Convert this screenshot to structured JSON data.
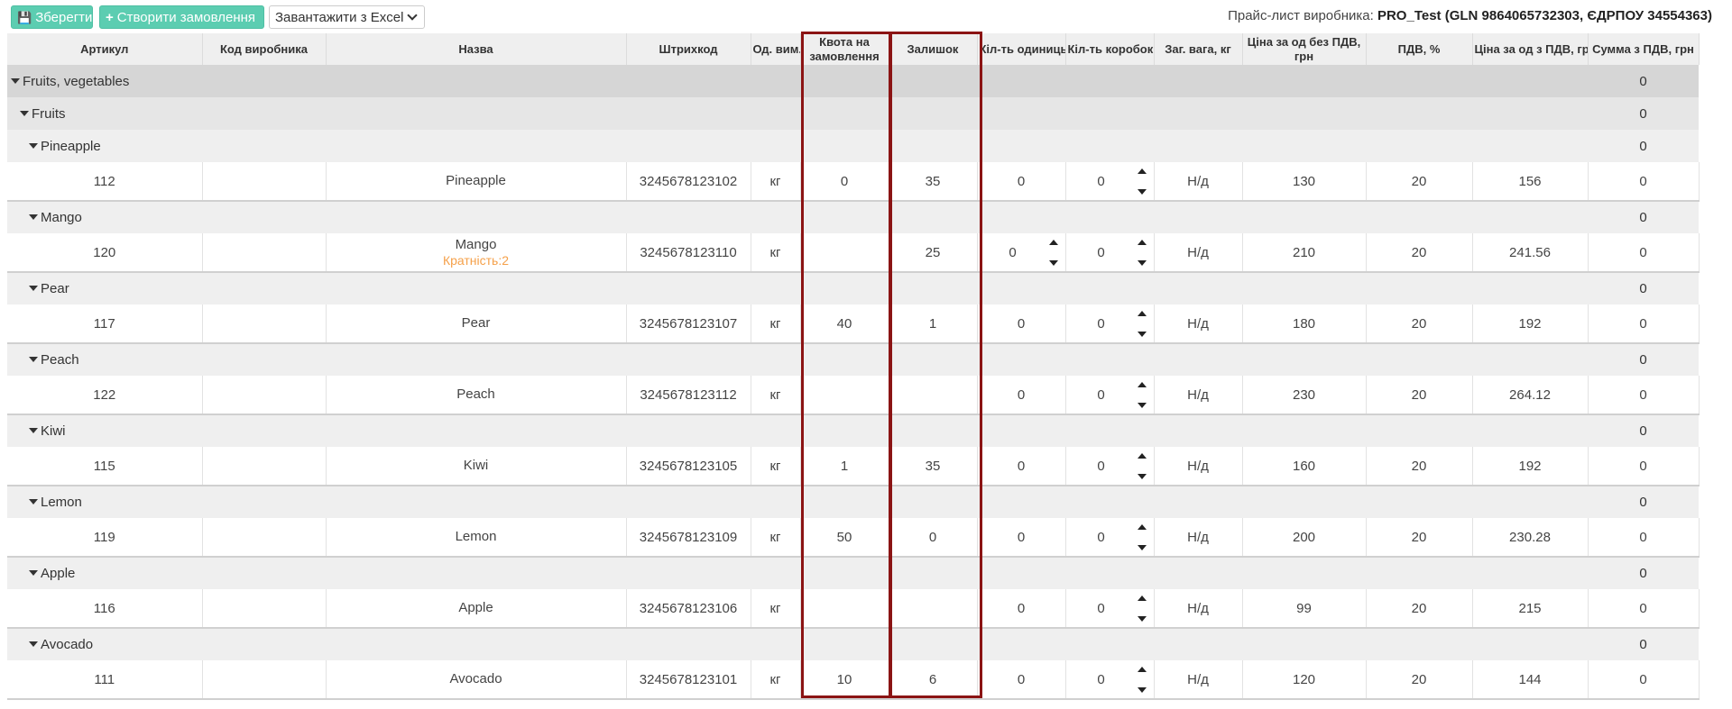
{
  "toolbar": {
    "save_label": "Зберегти",
    "create_order_label": "Створити замовлення",
    "excel_label": "Завантажити з Excel"
  },
  "supplier": {
    "prefix": "Прайс-лист виробника:",
    "name": "PRO_Test (GLN 9864065732303, ЄДРПОУ 34554363)"
  },
  "columns": {
    "article": "Артикул",
    "mfr_code": "Код виробника",
    "name": "Назва",
    "barcode": "Штрихкод",
    "unit": "Од. вим.",
    "quota": "Квота на замовлення",
    "stock": "Залишок",
    "qty_units": "Кіл-ть одиниць",
    "qty_boxes": "Кіл-ть коробок",
    "weight": "Заг. вага, кг",
    "price_no_vat": "Ціна за од без ПДВ, грн",
    "vat": "ПДВ, %",
    "price_vat": "Ціна за од з ПДВ, грн",
    "sum_vat": "Сумма з ПДВ, грн"
  },
  "groups": {
    "level1": {
      "label": "Fruits, vegetables",
      "total": "0"
    },
    "level2": {
      "label": "Fruits",
      "total": "0"
    }
  },
  "items": [
    {
      "group": "Pineapple",
      "group_total": "0",
      "article": "112",
      "mfr_code": "",
      "name": "Pineapple",
      "multiplicity": "",
      "barcode": "3245678123102",
      "unit": "кг",
      "quota": "0",
      "stock": "35",
      "qty_units": "0",
      "qty_units_spinner": false,
      "qty_boxes": "0",
      "weight": "Н/д",
      "price_no_vat": "130",
      "vat": "20",
      "price_vat": "156",
      "sum_vat": "0"
    },
    {
      "group": "Mango",
      "group_total": "0",
      "article": "120",
      "mfr_code": "",
      "name": "Mango",
      "multiplicity": "Кратність:2",
      "barcode": "3245678123110",
      "unit": "кг",
      "quota": "",
      "stock": "25",
      "qty_units": "0",
      "qty_units_spinner": true,
      "qty_boxes": "0",
      "weight": "Н/д",
      "price_no_vat": "210",
      "vat": "20",
      "price_vat": "241.56",
      "sum_vat": "0"
    },
    {
      "group": "Pear",
      "group_total": "0",
      "article": "117",
      "mfr_code": "",
      "name": "Pear",
      "multiplicity": "",
      "barcode": "3245678123107",
      "unit": "кг",
      "quota": "40",
      "stock": "1",
      "qty_units": "0",
      "qty_units_spinner": false,
      "qty_boxes": "0",
      "weight": "Н/д",
      "price_no_vat": "180",
      "vat": "20",
      "price_vat": "192",
      "sum_vat": "0"
    },
    {
      "group": "Peach",
      "group_total": "0",
      "article": "122",
      "mfr_code": "",
      "name": "Peach",
      "multiplicity": "",
      "barcode": "3245678123112",
      "unit": "кг",
      "quota": "",
      "stock": "",
      "qty_units": "0",
      "qty_units_spinner": false,
      "qty_boxes": "0",
      "weight": "Н/д",
      "price_no_vat": "230",
      "vat": "20",
      "price_vat": "264.12",
      "sum_vat": "0"
    },
    {
      "group": "Kiwi",
      "group_total": "0",
      "article": "115",
      "mfr_code": "",
      "name": "Kiwi",
      "multiplicity": "",
      "barcode": "3245678123105",
      "unit": "кг",
      "quota": "1",
      "stock": "35",
      "qty_units": "0",
      "qty_units_spinner": false,
      "qty_boxes": "0",
      "weight": "Н/д",
      "price_no_vat": "160",
      "vat": "20",
      "price_vat": "192",
      "sum_vat": "0"
    },
    {
      "group": "Lemon",
      "group_total": "0",
      "article": "119",
      "mfr_code": "",
      "name": "Lemon",
      "multiplicity": "",
      "barcode": "3245678123109",
      "unit": "кг",
      "quota": "50",
      "stock": "0",
      "qty_units": "0",
      "qty_units_spinner": false,
      "qty_boxes": "0",
      "weight": "Н/д",
      "price_no_vat": "200",
      "vat": "20",
      "price_vat": "230.28",
      "sum_vat": "0"
    },
    {
      "group": "Apple",
      "group_total": "0",
      "article": "116",
      "mfr_code": "",
      "name": "Apple",
      "multiplicity": "",
      "barcode": "3245678123106",
      "unit": "кг",
      "quota": "",
      "stock": "",
      "qty_units": "0",
      "qty_units_spinner": false,
      "qty_boxes": "0",
      "weight": "Н/д",
      "price_no_vat": "99",
      "vat": "20",
      "price_vat": "215",
      "sum_vat": "0"
    },
    {
      "group": "Avocado",
      "group_total": "0",
      "article": "111",
      "mfr_code": "",
      "name": "Avocado",
      "multiplicity": "",
      "barcode": "3245678123101",
      "unit": "кг",
      "quota": "10",
      "stock": "6",
      "qty_units": "0",
      "qty_units_spinner": false,
      "qty_boxes": "0",
      "weight": "Н/д",
      "price_no_vat": "120",
      "vat": "20",
      "price_vat": "144",
      "sum_vat": "0"
    }
  ],
  "colors": {
    "accent_green": "#5ccdb1",
    "highlight_border": "#8b1414",
    "multiplicity_text": "#f5a049"
  }
}
